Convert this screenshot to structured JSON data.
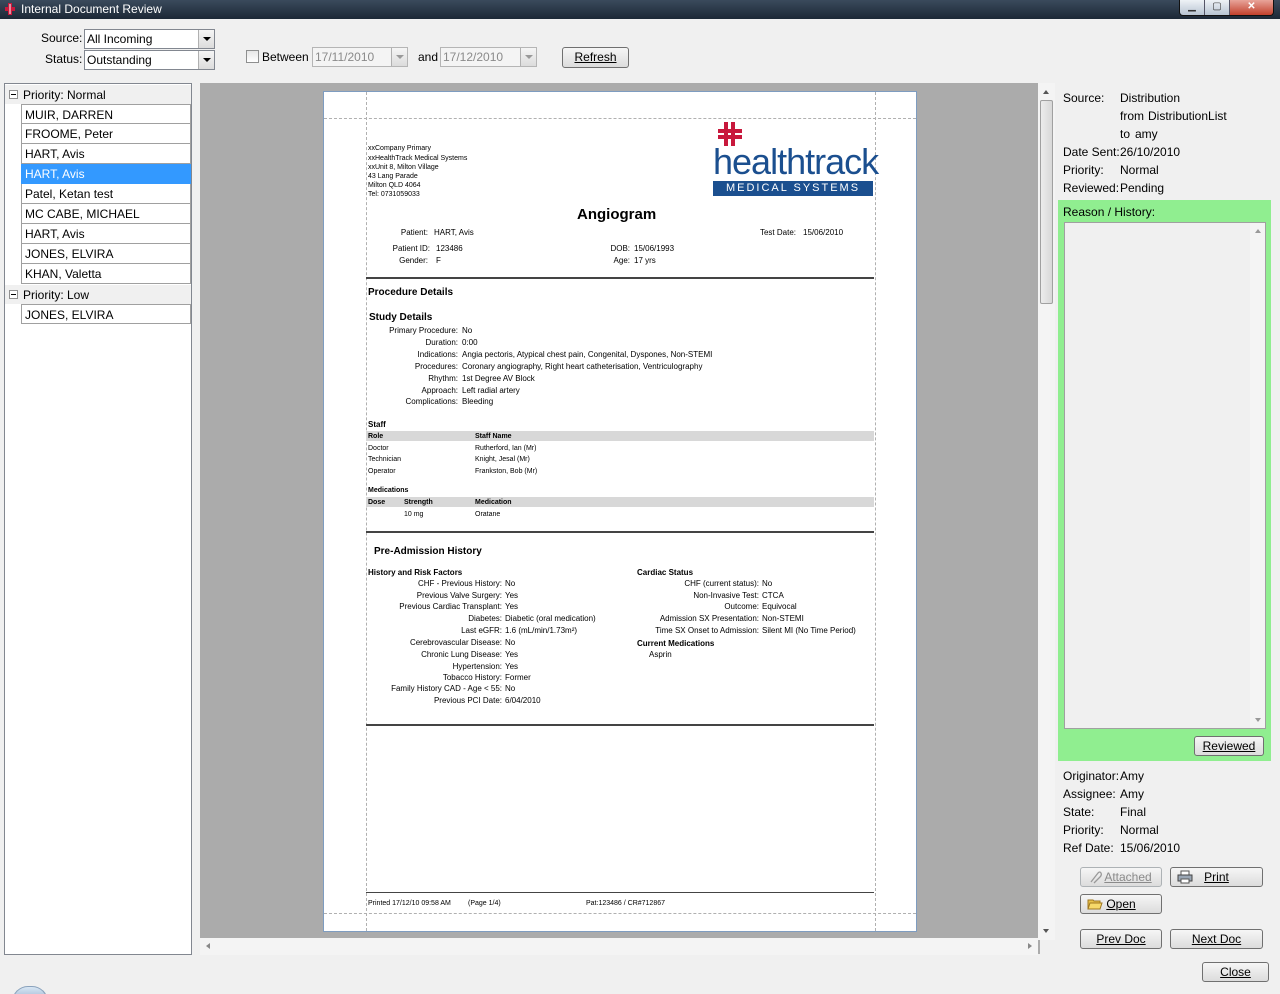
{
  "window": {
    "title": "Internal Document Review",
    "controls": {
      "minimize": "▁",
      "maximize": "▢",
      "close": "✕"
    }
  },
  "toolbar": {
    "source_label": "Source:",
    "source_value": "All Incoming",
    "status_label": "Status:",
    "status_value": "Outstanding",
    "between_label": "Between",
    "between_checked": false,
    "date_from": "17/11/2010",
    "and_label": "and",
    "date_to": "17/12/2010",
    "refresh_label": "Refresh"
  },
  "list": {
    "groups": [
      {
        "header": "Priority: Normal",
        "items": [
          {
            "name": "MUIR, DARREN"
          },
          {
            "name": "FROOME, Peter"
          },
          {
            "name": "HART, Avis"
          },
          {
            "name": "HART, Avis",
            "selected": true
          },
          {
            "name": "Patel, Ketan test"
          },
          {
            "name": "MC CABE, MICHAEL"
          },
          {
            "name": "HART, Avis"
          },
          {
            "name": "JONES, ELVIRA"
          },
          {
            "name": "KHAN, Valetta"
          }
        ]
      },
      {
        "header": "Priority: Low",
        "items": [
          {
            "name": "JONES, ELVIRA"
          }
        ]
      }
    ]
  },
  "document": {
    "company_lines": [
      "xxCompany Primary",
      "xxHealthTrack Medical Systems",
      "xxUnit 8, Milton Village",
      "43 Lang Parade",
      "Milton QLD  4064",
      "Tel: 0731059033"
    ],
    "logo_main": "healthtrack",
    "logo_sub": "MEDICAL SYSTEMS",
    "title": "Angiogram",
    "patient_label": "Patient:",
    "patient_value": "HART, Avis",
    "test_date_label": "Test Date:",
    "test_date_value": "15/06/2010",
    "patient_id_label": "Patient ID:",
    "patient_id_value": "123486",
    "dob_label": "DOB:",
    "dob_value": "15/06/1993",
    "gender_label": "Gender:",
    "gender_value": "F",
    "age_label": "Age:",
    "age_value": "17 yrs",
    "procedure_details_heading": "Procedure Details",
    "study_details_heading": "Study Details",
    "study_details": [
      {
        "label": "Primary Procedure:",
        "value": "No"
      },
      {
        "label": "Duration:",
        "value": "0:00"
      },
      {
        "label": "Indications:",
        "value": "Angia pectoris, Atypical chest pain, Congenital, Dyspones, Non-STEMI"
      },
      {
        "label": "Procedures:",
        "value": "Coronary angiography, Right heart catheterisation, Ventriculography"
      },
      {
        "label": "Rhythm:",
        "value": "1st Degree AV Block"
      },
      {
        "label": "Approach:",
        "value": "Left radial artery"
      },
      {
        "label": "Complications:",
        "value": "Bleeding"
      }
    ],
    "staff_heading": "Staff",
    "staff_columns": [
      "Role",
      "Staff Name"
    ],
    "staff_rows": [
      {
        "role": "Doctor",
        "name": "Rutherford, Ian (Mr)"
      },
      {
        "role": "Technician",
        "name": "Knight, Jesal (Mr)"
      },
      {
        "role": "Operator",
        "name": "Frankston, Bob (Mr)"
      }
    ],
    "medications_heading": "Medications",
    "med_columns": [
      "Dose",
      "Strength",
      "Medication"
    ],
    "med_rows": [
      {
        "dose": "",
        "strength": "10 mg",
        "medication": "Oratane"
      }
    ],
    "preadmission_heading": "Pre-Admission History",
    "history_heading": "History and Risk Factors",
    "history": [
      {
        "label": "CHF - Previous History:",
        "value": "No"
      },
      {
        "label": "Previous Valve Surgery:",
        "value": "Yes"
      },
      {
        "label": "Previous Cardiac Transplant:",
        "value": "Yes"
      },
      {
        "label": "Diabetes:",
        "value": "Diabetic (oral medication)"
      },
      {
        "label": "Last eGFR:",
        "value": "1.6 (mL/min/1.73m²)"
      },
      {
        "label": "Cerebrovascular Disease:",
        "value": "No"
      },
      {
        "label": "Chronic Lung Disease:",
        "value": "Yes"
      },
      {
        "label": "Hypertension:",
        "value": "Yes"
      },
      {
        "label": "Tobacco History:",
        "value": "Former"
      },
      {
        "label": "Family History CAD - Age < 55:",
        "value": "No"
      },
      {
        "label": "Previous PCI Date:",
        "value": "6/04/2010"
      }
    ],
    "cardiac_heading": "Cardiac Status",
    "cardiac": [
      {
        "label": "CHF (current status):",
        "value": "No"
      },
      {
        "label": "Non-Invasive Test:",
        "value": "CTCA"
      },
      {
        "label": "Outcome:",
        "value": "Equivocal"
      },
      {
        "label": "Admission SX Presentation:",
        "value": "Non-STEMI"
      },
      {
        "label": "Time SX Onset to Admission:",
        "value": "Silent MI (No Time Period)"
      }
    ],
    "current_meds_heading": "Current Medications",
    "current_meds": [
      "Asprin"
    ],
    "footer_printed": "Printed 17/12/10 09:58 AM",
    "footer_page": "(Page 1/4)",
    "footer_pat": "Pat:123486  /  CR#712867"
  },
  "details": {
    "source_label": "Source:",
    "source_value": "Distribution",
    "from_label": "from",
    "from_value": "DistributionList",
    "to_label": "to",
    "to_value": "amy",
    "date_sent_label": "Date Sent:",
    "date_sent_value": "26/10/2010",
    "priority_label": "Priority:",
    "priority_value": "Normal",
    "reviewed_label": "Reviewed:",
    "reviewed_value": "Pending",
    "reason_label": "Reason / History:",
    "reason_text": "",
    "reviewed_button": "Reviewed",
    "originator_label": "Originator:",
    "originator_value": "Amy",
    "assignee_label": "Assignee:",
    "assignee_value": "Amy",
    "state_label": "State:",
    "state_value": "Final",
    "priority2_label": "Priority:",
    "priority2_value": "Normal",
    "ref_date_label": "Ref Date:",
    "ref_date_value": "15/06/2010",
    "attached_button": "Attached",
    "print_button": "Print",
    "open_button": "Open",
    "prev_button": "Prev Doc",
    "next_button": "Next Doc",
    "close_button": "Close"
  },
  "colors": {
    "selection": "#3399ff",
    "reason_panel": "#90ee90",
    "logo_blue": "#1b4f8f",
    "logo_red": "#c8183c"
  }
}
